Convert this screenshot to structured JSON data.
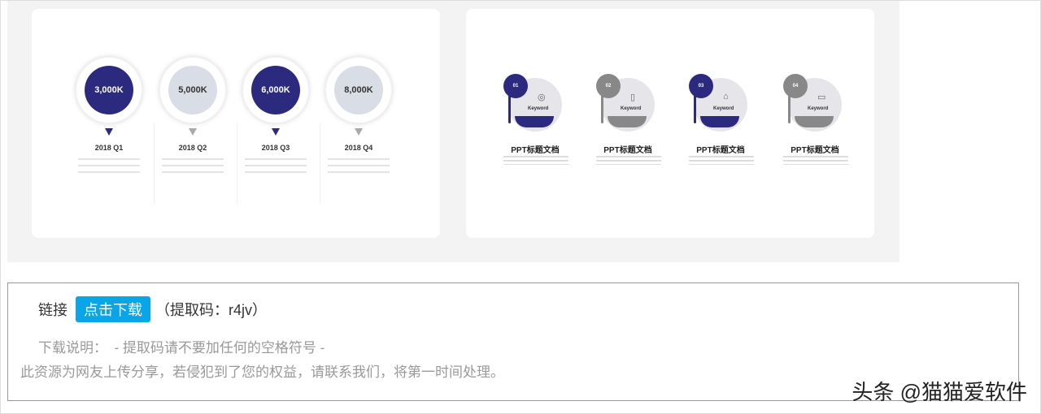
{
  "slide1": {
    "steps": [
      {
        "value": "3,000K",
        "label": "2018 Q1",
        "style": "dark"
      },
      {
        "value": "5,000K",
        "label": "2018 Q2",
        "style": "light"
      },
      {
        "value": "6,000K",
        "label": "2018 Q3",
        "style": "dark"
      },
      {
        "value": "8,000K",
        "label": "2018 Q4",
        "style": "light"
      }
    ]
  },
  "slide2": {
    "items": [
      {
        "num": "01",
        "keyword": "Keyword",
        "title": "PPT标题文档",
        "icon": "camera-icon"
      },
      {
        "num": "02",
        "keyword": "Keyword",
        "title": "PPT标题文档",
        "icon": "document-icon"
      },
      {
        "num": "03",
        "keyword": "Keyword",
        "title": "PPT标题文档",
        "icon": "graduation-cap-icon"
      },
      {
        "num": "04",
        "keyword": "Keyword",
        "title": "PPT标题文档",
        "icon": "laptop-icon"
      }
    ]
  },
  "download": {
    "link_label": "链接",
    "button": "点击下载",
    "code": "（提取码：r4jv）",
    "note": "下载说明：　- 提取码请不要加任何的空格符号 -",
    "disclaimer": "此资源为网友上传分享，若侵犯到了您的权益，请联系我们，将第一时间处理。"
  },
  "watermark": "头条 @猫猫爱软件",
  "colors": {
    "navy": "#2b2a7e",
    "light": "#d9dde6",
    "gray": "#888888",
    "button": "#0aa5e8"
  }
}
